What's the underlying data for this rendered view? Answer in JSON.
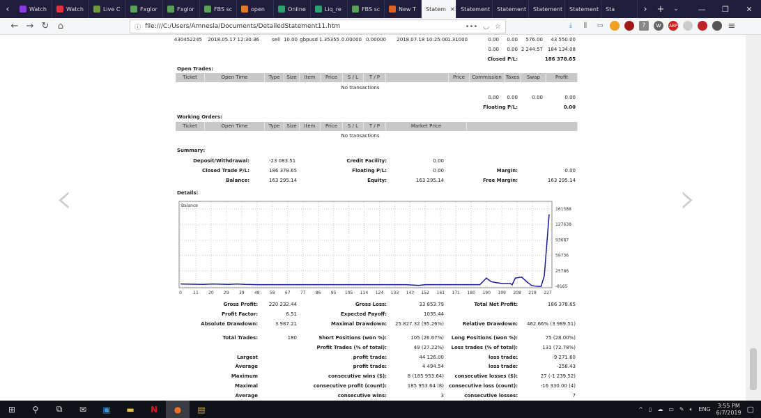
{
  "browser": {
    "tabs": [
      {
        "label": "Watch",
        "color": "#8a3be0"
      },
      {
        "label": "Watch",
        "color": "#e0303a"
      },
      {
        "label": "Live C",
        "color": "#6a9a3a"
      },
      {
        "label": "Fxglor",
        "color": "#5aa05a"
      },
      {
        "label": "Fxglor",
        "color": "#5aa05a"
      },
      {
        "label": "FBS sc",
        "color": "#5aa05a"
      },
      {
        "label": "open",
        "color": "#e07a20"
      },
      {
        "label": "Online",
        "color": "#2fa070"
      },
      {
        "label": "Liq_re",
        "color": "#2fa070"
      },
      {
        "label": "FBS sc",
        "color": "#5aa05a"
      },
      {
        "label": "New T",
        "color": "#e06020"
      }
    ],
    "active_tab": "Statem",
    "other_tabs": [
      "Statement",
      "Statement",
      "Statement",
      "Statement",
      "Sta"
    ],
    "url": "file:///C:/Users/Amnesia/Documents/DetailedStatement11.htm"
  },
  "closed": {
    "row": [
      "430452245",
      "2018.05.17 12:30:36",
      "sell",
      "10.00",
      "gbpusd",
      "1.35355",
      "0.00000",
      "0.00000",
      "2018.07.18 10:25:00",
      "1.31000",
      "0.00",
      "0.00",
      "576.00",
      "43 550.00"
    ],
    "totals": [
      "0.00",
      "0.00",
      "2 244.57",
      "184 134.08"
    ],
    "pl_label": "Closed P/L:",
    "pl_value": "186 378.65"
  },
  "open_trades": {
    "title": "Open Trades:",
    "headers": [
      "Ticket",
      "Open Time",
      "Type",
      "Size",
      "Item",
      "Price",
      "S / L",
      "T / P",
      "",
      "Price",
      "Commission",
      "Taxes",
      "Swap",
      "Profit"
    ],
    "empty": "No transactions",
    "totals": [
      "0.00",
      "0.00",
      "0.00",
      "0.00"
    ],
    "pl_label": "Floating P/L:",
    "pl_value": "0.00"
  },
  "working_orders": {
    "title": "Working Orders:",
    "headers": [
      "Ticket",
      "Open Time",
      "Type",
      "Size",
      "Item",
      "Price",
      "S / L",
      "T / P",
      "Market Price",
      ""
    ],
    "empty": "No transactions"
  },
  "summary": {
    "title": "Summary:",
    "rows": [
      [
        "Deposit/Withdrawal:",
        "-23 083.51",
        "Credit Facility:",
        "0.00",
        "",
        ""
      ],
      [
        "Closed Trade P/L:",
        "186 378.65",
        "Floating P/L:",
        "0.00",
        "Margin:",
        "0.00"
      ],
      [
        "Balance:",
        "163 295.14",
        "Equity:",
        "163 295.14",
        "Free Margin:",
        "163 295.14"
      ]
    ]
  },
  "details": {
    "title": "Details:"
  },
  "chart_data": {
    "type": "line",
    "legend": "Balance",
    "x_ticks": [
      "0",
      "11",
      "20",
      "29",
      "39",
      "48",
      "58",
      "67",
      "77",
      "86",
      "95",
      "105",
      "114",
      "124",
      "133",
      "143",
      "152",
      "161",
      "171",
      "180",
      "190",
      "199",
      "208",
      "218",
      "227"
    ],
    "y_ticks": [
      "161588",
      "127638",
      "93687",
      "59736",
      "25786",
      "-8165"
    ],
    "ylim": [
      -8165,
      161588
    ],
    "xlim": [
      0,
      229
    ],
    "series": [
      {
        "name": "Balance",
        "color": "#1a1a9a",
        "x": [
          0,
          14,
          20,
          30,
          35,
          40,
          48,
          140,
          148,
          152,
          186,
          190,
          193,
          196,
          200,
          205,
          206,
          208,
          212,
          215,
          218,
          220,
          222,
          224,
          226,
          229
        ],
        "y": [
          -3000,
          -4000,
          -3000,
          -4000,
          -3000,
          -4000,
          -4500,
          -4500,
          -6000,
          -4500,
          -4500,
          10000,
          2000,
          0,
          -2000,
          -2000,
          -5000,
          10000,
          12000,
          2000,
          -6000,
          -7500,
          -8165,
          -8165,
          15000,
          150000
        ]
      }
    ]
  },
  "stats": {
    "rows": [
      [
        "Gross Profit:",
        "220 232.44",
        "Gross Loss:",
        "33 853.79",
        "Total Net Profit:",
        "186 378.65"
      ],
      [
        "Profit Factor:",
        "6.51",
        "Expected Payoff:",
        "1035.44",
        "",
        ""
      ],
      [
        "Absolute Drawdown:",
        "3 987.21",
        "Maximal Drawdown:",
        "25 827.32 (95.26%)",
        "Relative Drawdown:",
        "462.66% (3 989.51)"
      ],
      [
        "Total Trades:",
        "180",
        "Short Positions (won %):",
        "105 (26.67%)",
        "Long Positions (won %):",
        "75 (28.00%)"
      ],
      [
        "",
        "",
        "Profit Trades (% of total):",
        "49 (27.22%)",
        "Loss trades (% of total):",
        "131 (72.78%)"
      ],
      [
        "Largest",
        "",
        "profit trade:",
        "44 126.00",
        "loss trade:",
        "-9 271.60"
      ],
      [
        "Average",
        "",
        "profit trade:",
        "4 494.54",
        "loss trade:",
        "-258.43"
      ],
      [
        "Maximum",
        "",
        "consecutive wins ($):",
        "8 (185 953.64)",
        "consecutive losses ($):",
        "27 (-1 239.52)"
      ],
      [
        "Maximal",
        "",
        "consecutive profit (count):",
        "185 953.64 (8)",
        "consecutive loss (count):",
        "-16 330.00 (4)"
      ],
      [
        "Average",
        "",
        "consecutive wins:",
        "3",
        "consecutive losses:",
        "7"
      ]
    ]
  },
  "taskbar": {
    "lang": "ENG",
    "time": "3:55 PM",
    "date": "6/7/2019"
  }
}
